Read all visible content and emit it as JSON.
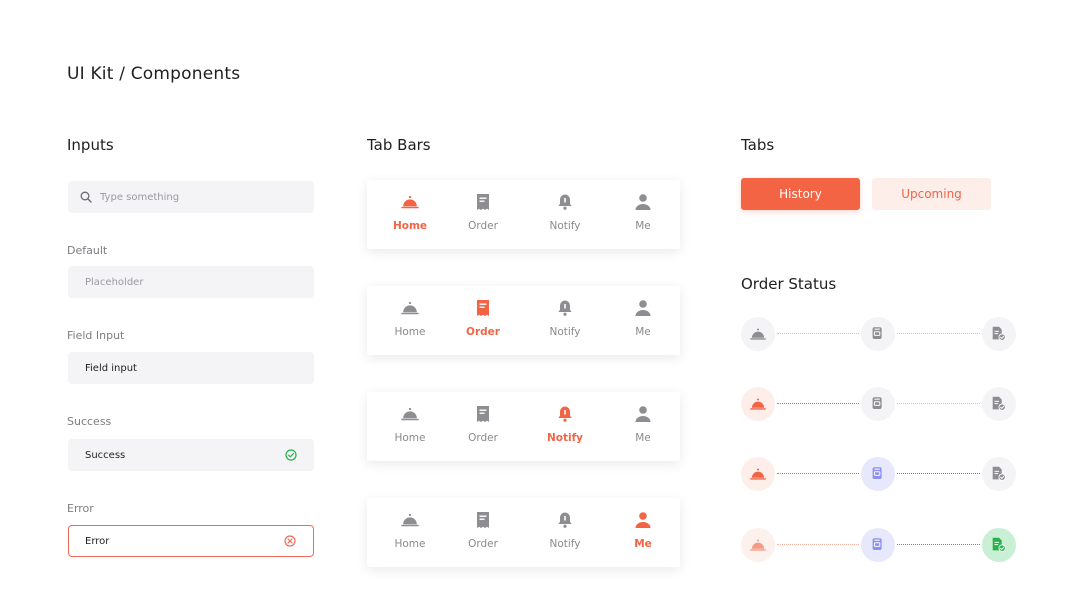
{
  "page": {
    "title": "UI Kit / Components"
  },
  "inputs": {
    "title": "Inputs",
    "search": {
      "placeholder": "Type something"
    },
    "default": {
      "label": "Default",
      "placeholder": "Placeholder"
    },
    "field_input": {
      "label": "Field Input",
      "value": "Field input"
    },
    "success": {
      "label": "Success",
      "value": "Success"
    },
    "error": {
      "label": "Error",
      "value": "Error"
    }
  },
  "tab_bars": {
    "title": "Tab Bars",
    "items": [
      {
        "label": "Home",
        "icon": "cloche-icon"
      },
      {
        "label": "Order",
        "icon": "receipt-icon"
      },
      {
        "label": "Notify",
        "icon": "bell-icon"
      },
      {
        "label": "Me",
        "icon": "user-icon"
      }
    ],
    "bars": [
      {
        "active": 0
      },
      {
        "active": 1
      },
      {
        "active": 2
      },
      {
        "active": 3
      }
    ]
  },
  "tabs": {
    "title": "Tabs",
    "items": [
      {
        "label": "History",
        "selected": true
      },
      {
        "label": "Upcoming",
        "selected": false
      }
    ]
  },
  "order_status": {
    "title": "Order Status",
    "steps_icons": [
      "cloche-icon",
      "bag-icon",
      "document-check-icon"
    ],
    "rows": [
      {
        "completed_steps": 0
      },
      {
        "completed_steps": 1
      },
      {
        "completed_steps": 2
      },
      {
        "completed_steps": 3
      }
    ]
  },
  "colors": {
    "accent": "#f26444",
    "accent_light": "#fdeeea",
    "purple_light": "#e7e8fb",
    "purple": "#8c90ee",
    "green_light": "#c9efd4",
    "green": "#27b24a",
    "gray_icon": "#8d8d92",
    "success": "#27b24a",
    "error": "#f06b5b"
  }
}
